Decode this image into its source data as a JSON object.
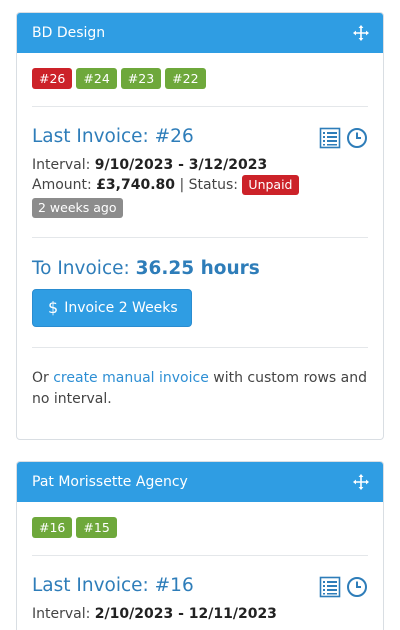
{
  "cards": [
    {
      "title": "BD Design",
      "tags": [
        {
          "label": "#26",
          "color": "red"
        },
        {
          "label": "#24",
          "color": "green"
        },
        {
          "label": "#23",
          "color": "green"
        },
        {
          "label": "#22",
          "color": "green"
        }
      ],
      "last_invoice": {
        "title": "Last Invoice: #26",
        "interval_label": "Interval:",
        "interval": "9/10/2023 - 3/12/2023",
        "amount_label": "Amount:",
        "amount": "£3,740.80",
        "status_sep": "| Status:",
        "status": "Unpaid",
        "ago": "2 weeks ago"
      },
      "to_invoice": {
        "label": "To Invoice:",
        "hours": "36.25 hours",
        "button_symbol": "$",
        "button_label": "Invoice 2 Weeks"
      },
      "manual": {
        "prefix": "Or",
        "link": "create manual invoice",
        "suffix": "with custom rows and no interval."
      }
    },
    {
      "title": "Pat Morissette Agency",
      "tags": [
        {
          "label": "#16",
          "color": "green"
        },
        {
          "label": "#15",
          "color": "green"
        }
      ],
      "last_invoice": {
        "title": "Last Invoice: #16",
        "interval_label": "Interval:",
        "interval": "2/10/2023 - 12/11/2023"
      }
    }
  ],
  "colors": {
    "header_blue": "#2f9de3",
    "title_blue": "#2e7db9",
    "tag_red": "#cc2229",
    "tag_green": "#6ea83b",
    "badge_gray": "#8c8c8c"
  },
  "icons": [
    "move-icon",
    "list-icon",
    "clock-icon"
  ]
}
